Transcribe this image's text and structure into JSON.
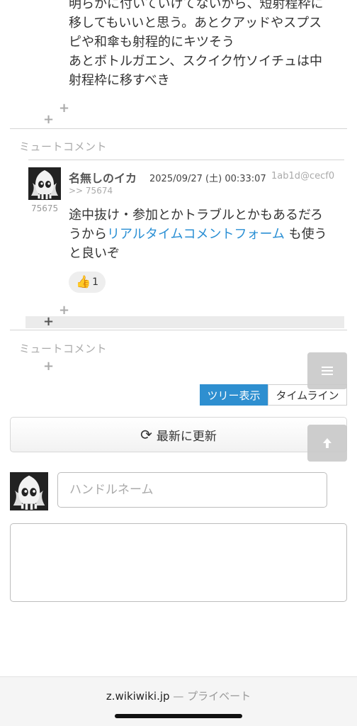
{
  "previous_comment": {
    "lines": [
      "明らかに付いていけてないから、短射程枠に",
      "移してもいいと思う。あとクアッドやスプス",
      "ピや和傘も射程的にキツそう",
      "あとボトルガエン、スクイク竹ソイチュは中",
      "射程枠に移すべき"
    ]
  },
  "mute_label": "ミュートコメント",
  "comment": {
    "name": "名無しのイカ",
    "date": "2025/09/27 (土) 00:33:07",
    "id": "1ab1d@cecf0",
    "reply_to": ">> 75674",
    "number": "75675",
    "body_line1": "途中抜け・参加とかトラブルとかもあるだろ",
    "body_line2_pre": "うから",
    "body_link": "リアルタイムコメントフォーム",
    "body_line2_post": " も使う",
    "body_line3": "と良いぞ",
    "like_count": "1"
  },
  "view_toggle": {
    "tree": "ツリー表示",
    "timeline": "タイムライン"
  },
  "refresh_label": "最新に更新",
  "form": {
    "name_placeholder": "ハンドルネーム",
    "name_value": "",
    "body_value": ""
  },
  "browser": {
    "domain": "z.wikiwiki.jp",
    "separator": " — ",
    "mode": "プライベート"
  },
  "icons": {
    "plus": "+",
    "menu": "menu-icon",
    "scroll_top": "arrow-up-icon",
    "refresh": "refresh-icon",
    "like": "thumbs-up-icon",
    "avatar": "squid-avatar"
  },
  "colors": {
    "accent": "#2e8fd0",
    "link": "#2a8fd4",
    "muted": "#aaaaaa"
  }
}
